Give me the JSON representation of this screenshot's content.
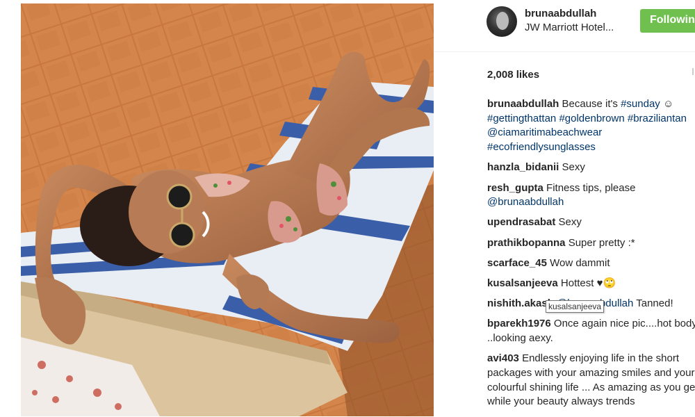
{
  "post": {
    "username": "brunaabdullah",
    "location": "JW Marriott Hotel...",
    "follow_label": "Following",
    "likes": "2,008 likes"
  },
  "caption": {
    "user": "brunaabdullah",
    "text": "Because it's",
    "emoji": "☺",
    "tags": [
      "#sunday",
      "#gettingthattan",
      "#goldenbrown",
      "#braziliantan",
      "@ciamaritimabeachwear",
      "#ecofriendlysunglasses"
    ]
  },
  "comments": [
    {
      "user": "hanzla_bidanii",
      "text": "Sexy"
    },
    {
      "user": "resh_gupta",
      "text": "Fitness tips, please",
      "mention": "@brunaabdullah"
    },
    {
      "user": "upendrasabat",
      "text": "Sexy"
    },
    {
      "user": "prathikbopanna",
      "text": "Super pretty :*"
    },
    {
      "user": "scarface_45",
      "text": "Wow dammit"
    },
    {
      "user": "kusalsanjeeva",
      "text": "Hottest ♥🙄"
    },
    {
      "user": "nishith.akash",
      "mention": "@brunaabdullah",
      "text": "Tanned!"
    },
    {
      "user": "bparekh1976",
      "text": "Once again nice pic....hot body. ..looking aexy."
    },
    {
      "user": "avi403",
      "text": "Endlessly enjoying life in the short packages with your amazing smiles and your colourful shining life ... As amazing as you get while your beauty always trends"
    }
  ],
  "tooltip": "kusalsanjeeva",
  "colors": {
    "follow_green": "#70c050",
    "link_blue": "#003569",
    "text": "#262626"
  },
  "icons": {
    "avatar": "profile-photo"
  }
}
